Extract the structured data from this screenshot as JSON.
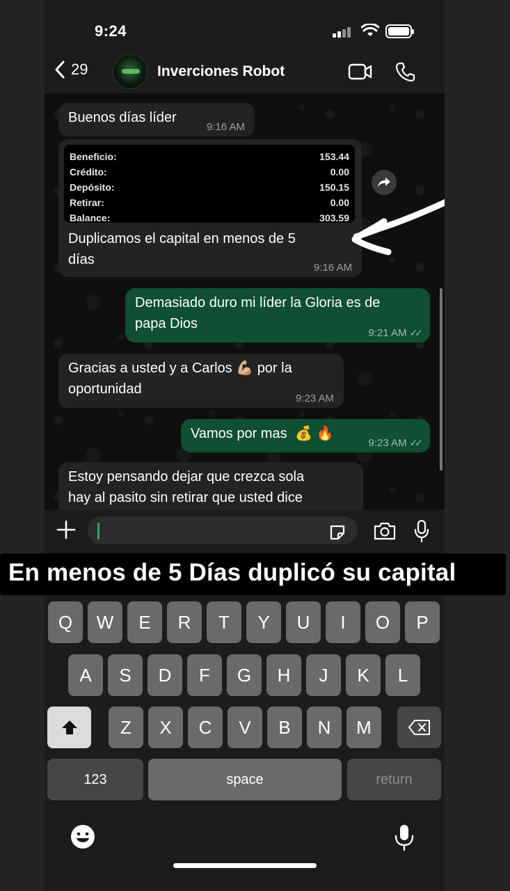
{
  "status_bar": {
    "time": "9:24"
  },
  "header": {
    "back_count": "29",
    "contact_name": "Inverciones Robot"
  },
  "messages": {
    "m1": {
      "text": "Buenos días líder",
      "time": "9:16 AM"
    },
    "m2": {
      "table": [
        {
          "label": "Beneficio:",
          "value": "153.44"
        },
        {
          "label": "Crédito:",
          "value": "0.00"
        },
        {
          "label": "Depósito:",
          "value": "150.15"
        },
        {
          "label": "Retirar:",
          "value": "0.00"
        },
        {
          "label": "Balance:",
          "value": "303.59"
        }
      ],
      "caption_line1": "Duplicamos el capital en menos de 5",
      "caption_line2": "días",
      "time": "9:16 AM"
    },
    "m3": {
      "line1": "Demasiado duro mi líder la Gloria es de",
      "line2": "papa Dios",
      "time": "9:21 AM"
    },
    "m4": {
      "line1_a": "Gracias a usted y a Carlos",
      "emoji": "💪🏼",
      "line1_b": "por la",
      "line2": "oportunidad",
      "time": "9:23 AM"
    },
    "m5": {
      "text": "Vamos por mas",
      "emoji": "💰 🔥",
      "time": "9:23 AM"
    },
    "m6": {
      "line1": "Estoy pensando dejar que crezca sola",
      "line2": "hay al pasito sin retirar que usted dice"
    }
  },
  "caption_banner": "En menos de 5 Días duplicó su capital",
  "keyboard": {
    "row1": [
      "Q",
      "W",
      "E",
      "R",
      "T",
      "Y",
      "U",
      "I",
      "O",
      "P"
    ],
    "row2": [
      "A",
      "S",
      "D",
      "F",
      "G",
      "H",
      "J",
      "K",
      "L"
    ],
    "row3": [
      "Z",
      "X",
      "C",
      "V",
      "B",
      "N",
      "M"
    ],
    "numbers": "123",
    "space": "space",
    "return": "return"
  },
  "colors": {
    "outgoing_bubble": "#0f4f33",
    "incoming_bubble": "#232323",
    "accent": "#1fae5a"
  }
}
